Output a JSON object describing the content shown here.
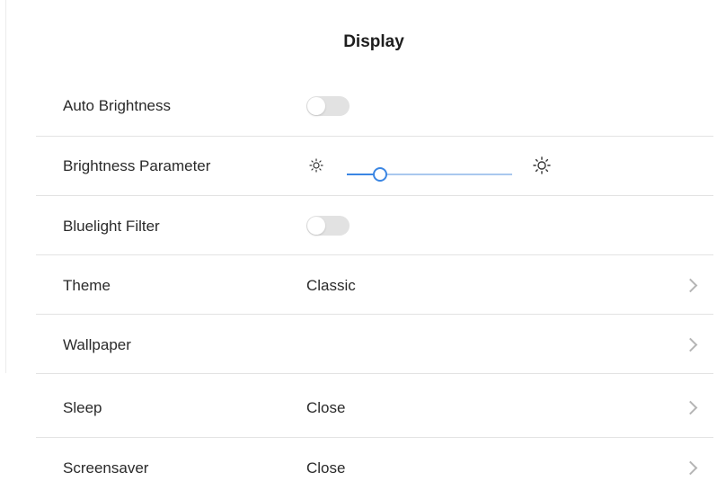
{
  "header": {
    "title": "Display"
  },
  "settings": {
    "auto_brightness": {
      "label": "Auto Brightness",
      "enabled": false
    },
    "brightness": {
      "label": "Brightness Parameter",
      "level": 0.2,
      "min_icon": "sun-small-icon",
      "max_icon": "sun-large-icon"
    },
    "bluelight": {
      "label": "Bluelight Filter",
      "enabled": false
    },
    "theme": {
      "label": "Theme",
      "value": "Classic"
    },
    "wallpaper": {
      "label": "Wallpaper"
    },
    "sleep": {
      "label": "Sleep",
      "value": "Close"
    },
    "screensaver": {
      "label": "Screensaver",
      "value": "Close"
    }
  },
  "colors": {
    "accent": "#3b86e3",
    "track": "#a9c8ee",
    "toggle_off": "#e2e2e2",
    "divider": "#e3e3e3"
  }
}
